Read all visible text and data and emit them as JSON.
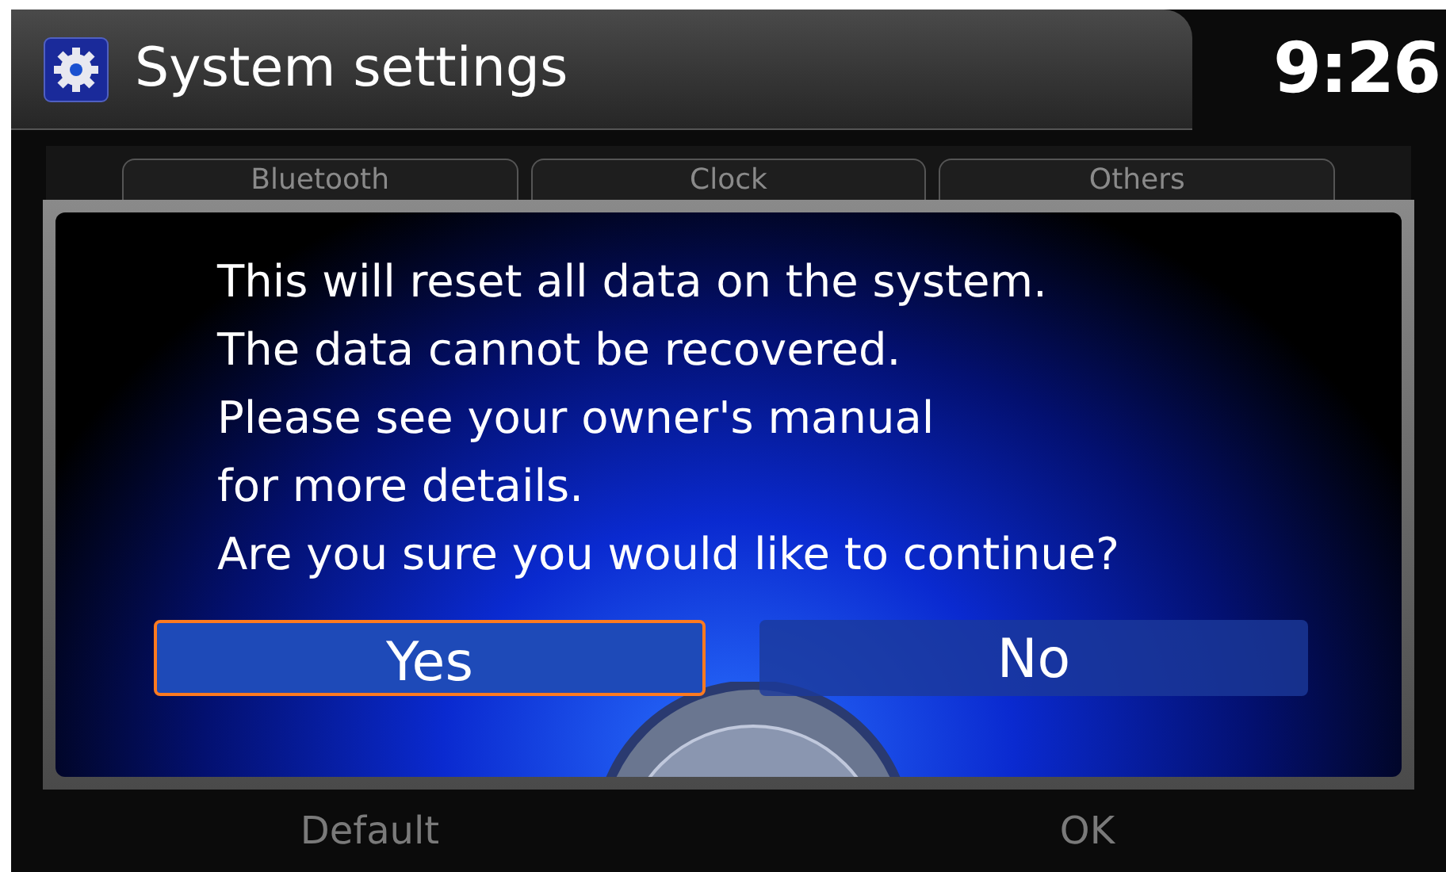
{
  "header": {
    "title": "System settings",
    "clock": "9:26"
  },
  "tabs": [
    {
      "label": "Bluetooth"
    },
    {
      "label": "Clock"
    },
    {
      "label": "Others"
    }
  ],
  "dialog": {
    "message_lines": [
      "This will reset all data on the system.",
      "The data cannot be recovered.",
      "Please see your owner's manual",
      "for more details.",
      "Are you sure you would like to continue?"
    ],
    "buttons": [
      {
        "label": "Yes",
        "selected": true
      },
      {
        "label": "No",
        "selected": false
      }
    ]
  },
  "footer": [
    "Default",
    "OK"
  ]
}
